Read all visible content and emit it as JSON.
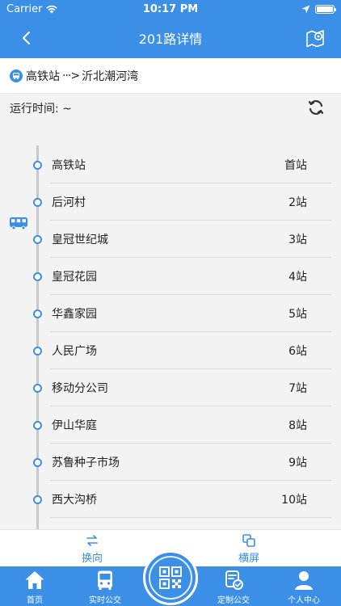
{
  "status_bar": {
    "carrier": "Carrier",
    "time": "10:17 PM"
  },
  "nav": {
    "title": "201路详情"
  },
  "route": {
    "from": "高铁站",
    "arrow": "···>",
    "to": "沂北潮河湾"
  },
  "run_time": {
    "label": "运行时间: ~"
  },
  "stations": [
    {
      "name": "高铁站",
      "count": "首站"
    },
    {
      "name": "后河村",
      "count": "2站"
    },
    {
      "name": "皇冠世纪城",
      "count": "3站"
    },
    {
      "name": "皇冠花园",
      "count": "4站"
    },
    {
      "name": "华鑫家园",
      "count": "5站"
    },
    {
      "name": "人民广场",
      "count": "6站"
    },
    {
      "name": "移动分公司",
      "count": "7站"
    },
    {
      "name": "伊山华庭",
      "count": "8站"
    },
    {
      "name": "苏鲁种子市场",
      "count": "9站"
    },
    {
      "name": "西大沟桥",
      "count": "10站"
    }
  ],
  "actions": {
    "reverse": "换向",
    "landscape": "横屏"
  },
  "tabs": {
    "home": "首页",
    "realtime": "实时公交",
    "custom": "定制公交",
    "user": "个人中心"
  },
  "colors": {
    "primary": "#3b8fe6",
    "background": "#f3f3f3"
  }
}
